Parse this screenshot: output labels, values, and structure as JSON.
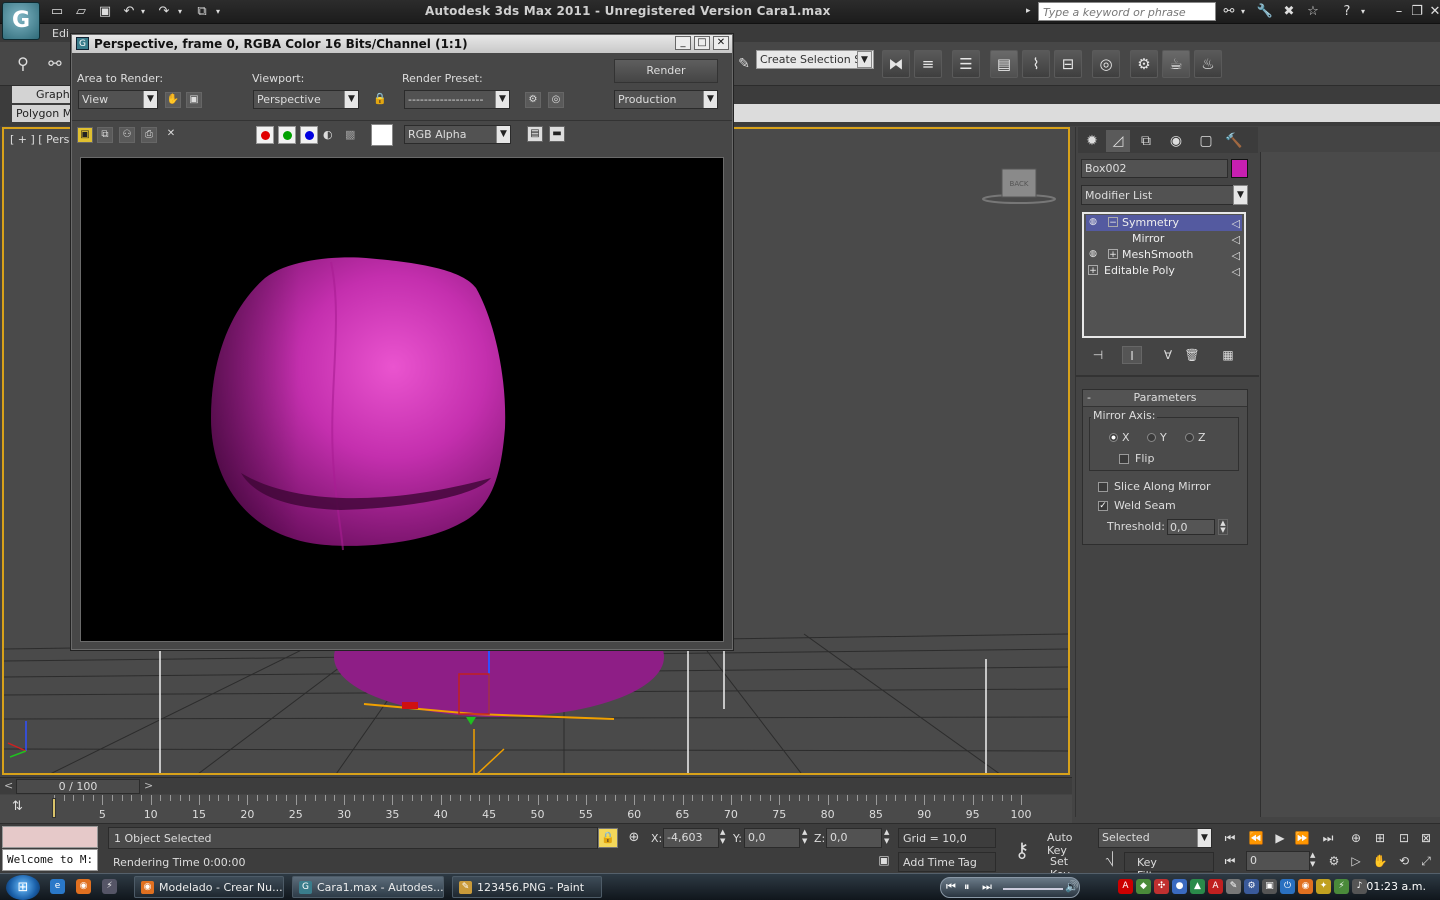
{
  "app": {
    "title": "Autodesk 3ds Max  2011  - Unregistered Version    Cara1.max",
    "logo": "G",
    "edit_label": "Edi",
    "search_placeholder": "Type a keyword or phrase"
  },
  "toolbar": {
    "selection_set": "Create Selection Se"
  },
  "ribbon": {
    "tab1": "Graphi",
    "tab2": "Polygon M"
  },
  "viewport": {
    "label": "[ + ] [ Perspe",
    "viewcube_label": "BACK"
  },
  "render_window": {
    "title": "Perspective, frame 0, RGBA Color 16 Bits/Channel (1:1)",
    "area_label": "Area to Render:",
    "area_value": "View",
    "viewport_label": "Viewport:",
    "viewport_value": "Perspective",
    "preset_label": "Render Preset:",
    "preset_value": "-------------------",
    "render_button": "Render",
    "production_value": "Production",
    "channel_value": "RGB Alpha"
  },
  "command_panel": {
    "object_name": "Box002",
    "object_color": "#c71fb0",
    "modifier_list": "Modifier List",
    "stack": [
      "Symmetry",
      "Mirror",
      "MeshSmooth",
      "Editable Poly"
    ],
    "parameters_title": "Parameters",
    "mirror_axis_label": "Mirror Axis:",
    "axes": [
      "X",
      "Y",
      "Z"
    ],
    "flip_label": "Flip",
    "slice_label": "Slice Along Mirror",
    "weld_label": "Weld Seam",
    "threshold_label": "Threshold:",
    "threshold_value": "0,0"
  },
  "timeline": {
    "position": "0 / 100",
    "ticks": [
      "5",
      "10",
      "15",
      "20",
      "25",
      "30",
      "35",
      "40",
      "45",
      "50",
      "55",
      "60",
      "65",
      "70",
      "75",
      "80",
      "85",
      "90",
      "95",
      "100"
    ]
  },
  "status": {
    "selected": "1 Object Selected",
    "render_time": "Rendering Time  0:00:00",
    "maxscript": "Welcome to M:",
    "x_label": "X:",
    "x_value": "-4,603",
    "y_label": "Y:",
    "y_value": "0,0",
    "z_label": "Z:",
    "z_value": "0,0",
    "grid": "Grid = 10,0",
    "add_time_tag": "Add Time Tag",
    "auto_key": "Auto Key",
    "set_key": "Set Key",
    "selected_dropdown": "Selected",
    "key_filters": "Key Filters...",
    "frame": "0"
  },
  "taskbar": {
    "tasks": [
      "Modelado - Crear Nu...",
      "Cara1.max - Autodes...",
      "123456.PNG - Paint"
    ],
    "clock": "01:23 a.m."
  }
}
